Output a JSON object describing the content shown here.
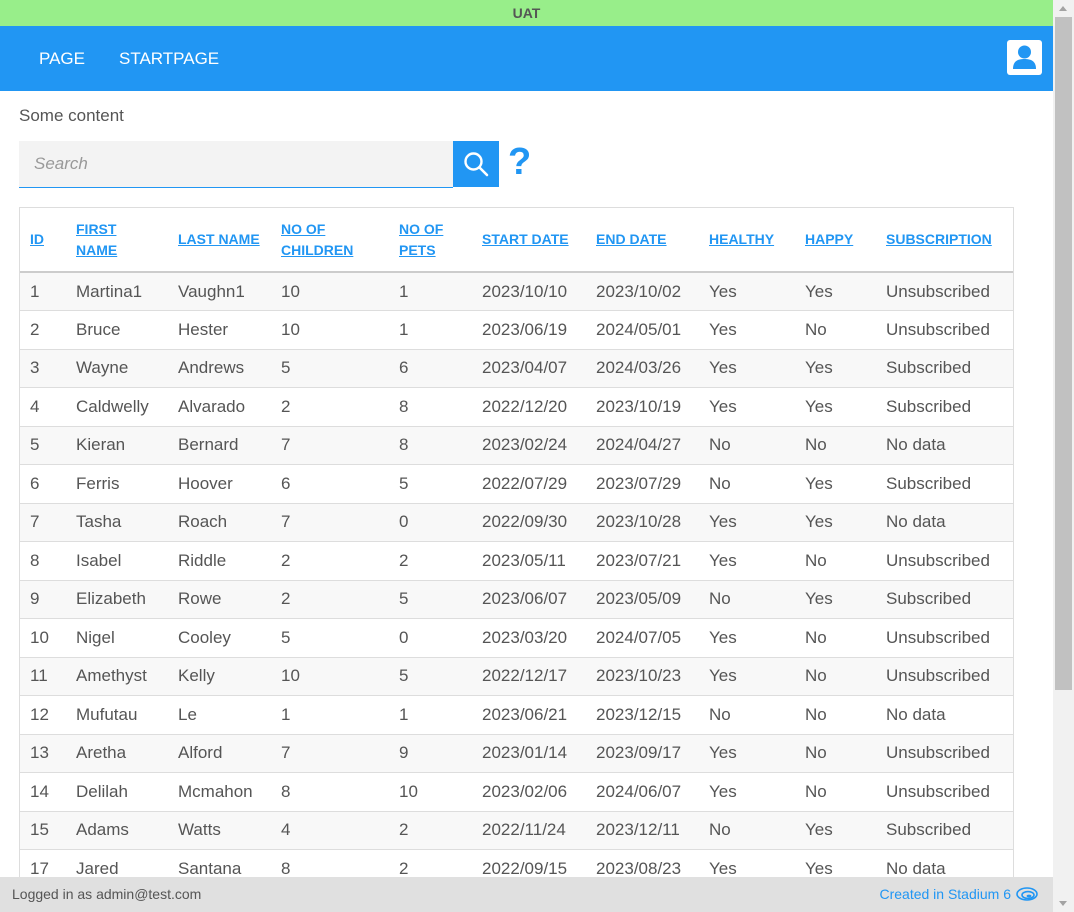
{
  "env": {
    "label": "UAT"
  },
  "nav": {
    "items": [
      {
        "label": "PAGE"
      },
      {
        "label": "STARTPAGE"
      }
    ]
  },
  "content": {
    "label": "Some content"
  },
  "search": {
    "placeholder": "Search",
    "value": ""
  },
  "help": {
    "label": "?"
  },
  "table": {
    "headers": [
      "ID",
      "FIRST NAME",
      "LAST NAME",
      "NO OF CHILDREN",
      "NO OF PETS",
      "START DATE",
      "END DATE",
      "HEALTHY",
      "HAPPY",
      "SUBSCRIPTION"
    ],
    "rows": [
      [
        "1",
        "Martina1",
        "Vaughn1",
        "10",
        "1",
        "2023/10/10",
        "2023/10/02",
        "Yes",
        "Yes",
        "Unsubscribed"
      ],
      [
        "2",
        "Bruce",
        "Hester",
        "10",
        "1",
        "2023/06/19",
        "2024/05/01",
        "Yes",
        "No",
        "Unsubscribed"
      ],
      [
        "3",
        "Wayne",
        "Andrews",
        "5",
        "6",
        "2023/04/07",
        "2024/03/26",
        "Yes",
        "Yes",
        "Subscribed"
      ],
      [
        "4",
        "Caldwelly",
        "Alvarado",
        "2",
        "8",
        "2022/12/20",
        "2023/10/19",
        "Yes",
        "Yes",
        "Subscribed"
      ],
      [
        "5",
        "Kieran",
        "Bernard",
        "7",
        "8",
        "2023/02/24",
        "2024/04/27",
        "No",
        "No",
        "No data"
      ],
      [
        "6",
        "Ferris",
        "Hoover",
        "6",
        "5",
        "2022/07/29",
        "2023/07/29",
        "No",
        "Yes",
        "Subscribed"
      ],
      [
        "7",
        "Tasha",
        "Roach",
        "7",
        "0",
        "2022/09/30",
        "2023/10/28",
        "Yes",
        "Yes",
        "No data"
      ],
      [
        "8",
        "Isabel",
        "Riddle",
        "2",
        "2",
        "2023/05/11",
        "2023/07/21",
        "Yes",
        "No",
        "Unsubscribed"
      ],
      [
        "9",
        "Elizabeth",
        "Rowe",
        "2",
        "5",
        "2023/06/07",
        "2023/05/09",
        "No",
        "Yes",
        "Subscribed"
      ],
      [
        "10",
        "Nigel",
        "Cooley",
        "5",
        "0",
        "2023/03/20",
        "2024/07/05",
        "Yes",
        "No",
        "Unsubscribed"
      ],
      [
        "11",
        "Amethyst",
        "Kelly",
        "10",
        "5",
        "2022/12/17",
        "2023/10/23",
        "Yes",
        "No",
        "Unsubscribed"
      ],
      [
        "12",
        "Mufutau",
        "Le",
        "1",
        "1",
        "2023/06/21",
        "2023/12/15",
        "No",
        "No",
        "No data"
      ],
      [
        "13",
        "Aretha",
        "Alford",
        "7",
        "9",
        "2023/01/14",
        "2023/09/17",
        "Yes",
        "No",
        "Unsubscribed"
      ],
      [
        "14",
        "Delilah",
        "Mcmahon",
        "8",
        "10",
        "2023/02/06",
        "2024/06/07",
        "Yes",
        "No",
        "Unsubscribed"
      ],
      [
        "15",
        "Adams",
        "Watts",
        "4",
        "2",
        "2022/11/24",
        "2023/12/11",
        "No",
        "Yes",
        "Subscribed"
      ],
      [
        "17",
        "Jared",
        "Santana",
        "8",
        "2",
        "2022/09/15",
        "2023/08/23",
        "Yes",
        "Yes",
        "No data"
      ]
    ]
  },
  "footer": {
    "logged_in": "Logged in as admin@test.com",
    "created_in": "Created in Stadium 6"
  },
  "colors": {
    "env_bar": "#98ee8a",
    "primary": "#2196f3",
    "footer_bg": "#e0e0e0",
    "text": "#555555"
  },
  "icons": {
    "user": "user-icon",
    "search": "search-icon",
    "help": "question-icon",
    "stadium": "stadium-logo-icon"
  }
}
